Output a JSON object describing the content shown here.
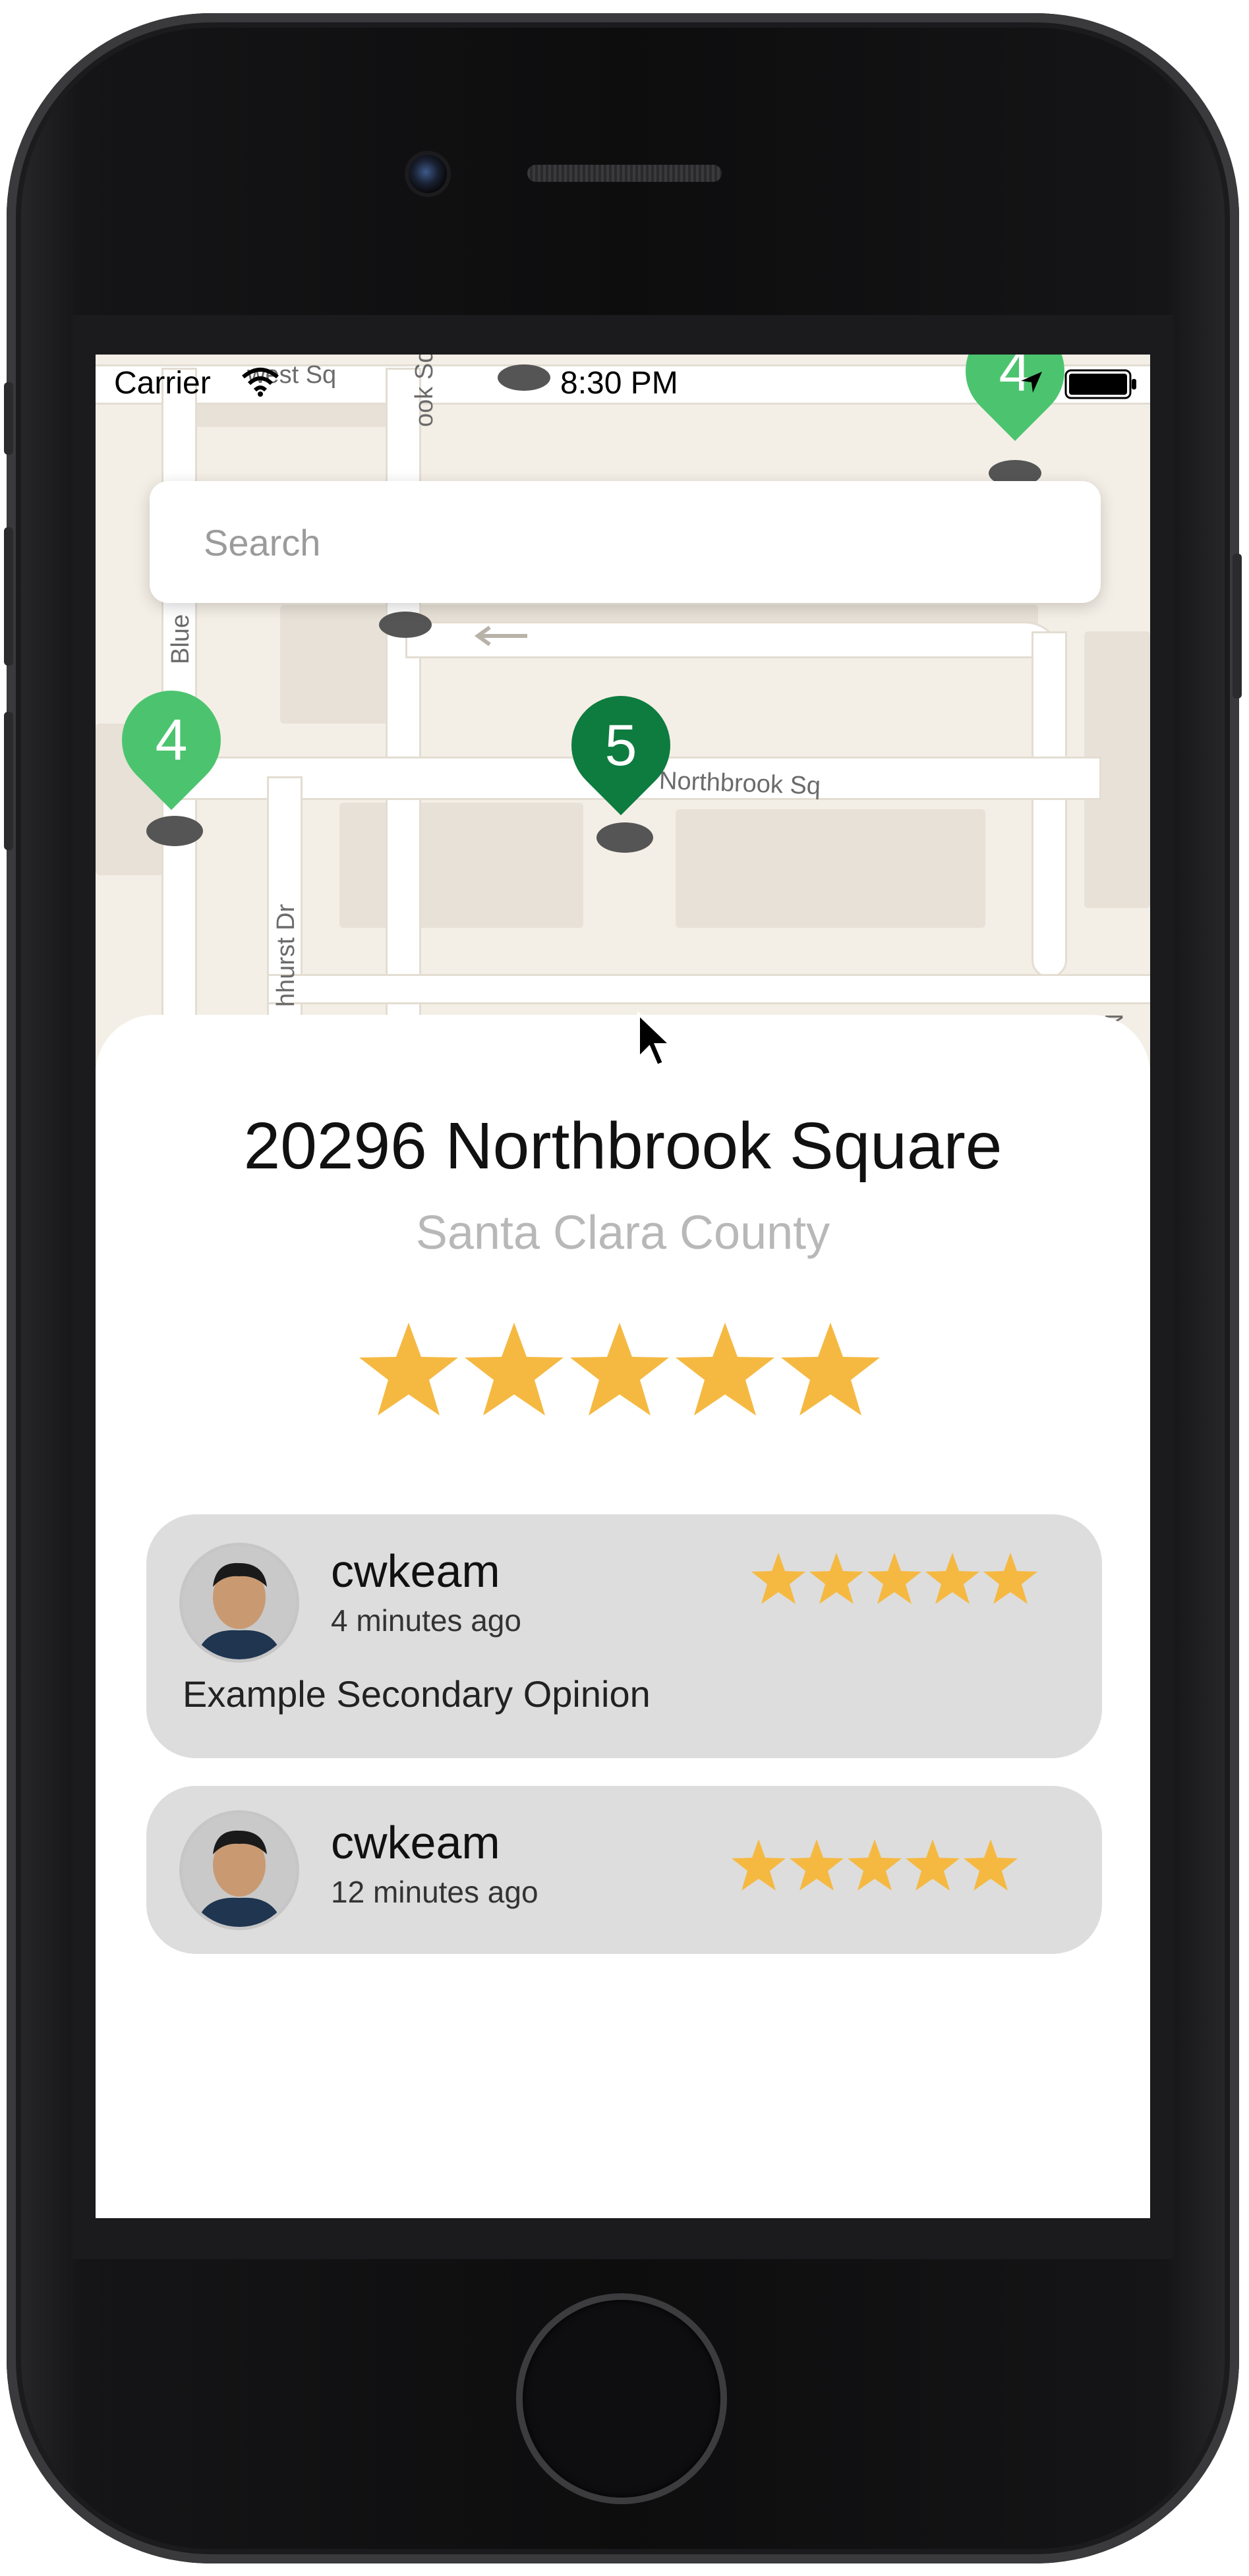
{
  "status_bar": {
    "carrier": "Carrier",
    "time": "8:30 PM"
  },
  "search": {
    "placeholder": "Search"
  },
  "map": {
    "street_labels": {
      "west_sq": "west Sq",
      "brook_sq": "ook Sq",
      "blue": "Blue",
      "northbrook_sq": "Northbrook Sq",
      "hurst_dr": "hhurst Dr",
      "nor": "Nor"
    },
    "pins": [
      {
        "label": "4",
        "color": "#4cc46f"
      },
      {
        "label": "4",
        "color": "#4cc46f"
      },
      {
        "label": "5",
        "color": "#0e7c3f"
      }
    ]
  },
  "place": {
    "title": "20296 Northbrook Square",
    "county": "Santa Clara County",
    "rating": 5,
    "rating_max": 5
  },
  "reviews": [
    {
      "user": "cwkeam",
      "time_ago": "4 minutes ago",
      "opinion": "Example Secondary Opinion",
      "rating": 5
    },
    {
      "user": "cwkeam",
      "time_ago": "12 minutes ago",
      "opinion": "",
      "rating": 5
    }
  ],
  "colors": {
    "star": "#f5b942",
    "card_bg": "#dddddd",
    "map_bg": "#f4efe6"
  },
  "icons": [
    "wifi-icon",
    "location-arrow-icon",
    "battery-icon",
    "star-icon",
    "avatar",
    "pointer-cursor-icon"
  ]
}
